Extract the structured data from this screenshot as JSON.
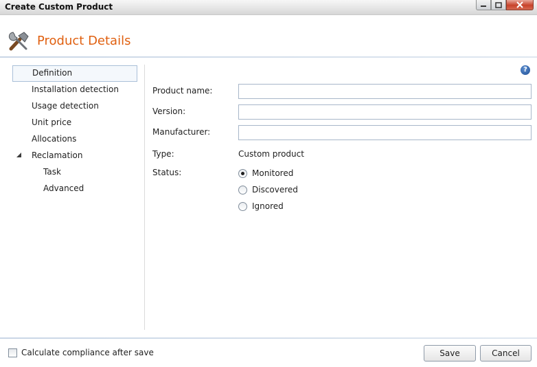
{
  "window": {
    "title": "Create Custom Product",
    "controls": [
      "minimize-icon",
      "maximize-icon",
      "close-icon"
    ]
  },
  "header": {
    "title": "Product Details",
    "icon": "tools-icon",
    "accent_color": "#e06010"
  },
  "help": {
    "glyph": "?"
  },
  "nav": {
    "items": [
      {
        "label": "Definition",
        "selected": true
      },
      {
        "label": "Installation detection"
      },
      {
        "label": "Usage detection"
      },
      {
        "label": "Unit price"
      },
      {
        "label": "Allocations"
      },
      {
        "label": "Reclamation",
        "expanded": true
      },
      {
        "label": "Task",
        "child": true
      },
      {
        "label": "Advanced",
        "child": true
      }
    ]
  },
  "form": {
    "product_name_label": "Product name:",
    "product_name_value": "",
    "version_label": "Version:",
    "version_value": "",
    "manufacturer_label": "Manufacturer:",
    "manufacturer_value": "",
    "type_label": "Type:",
    "type_value": "Custom product",
    "status_label": "Status:",
    "status_options": [
      {
        "label": "Monitored",
        "checked": true
      },
      {
        "label": "Discovered",
        "checked": false
      },
      {
        "label": "Ignored",
        "checked": false
      }
    ]
  },
  "footer": {
    "compliance_label": "Calculate compliance after save",
    "compliance_checked": false,
    "save_label": "Save",
    "cancel_label": "Cancel"
  }
}
